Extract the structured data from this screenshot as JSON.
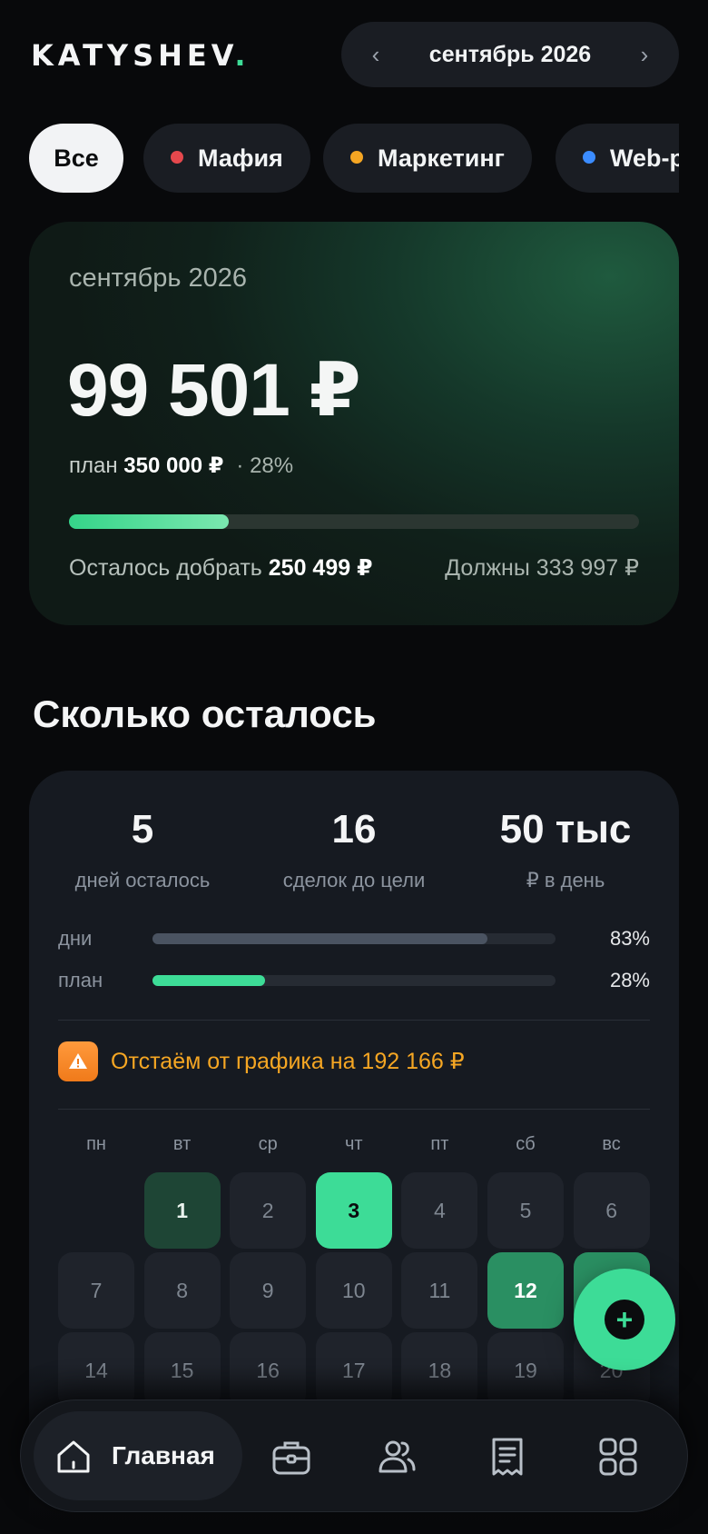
{
  "header": {
    "logo": "KATYSHEV",
    "logo_dot": ".",
    "month_label": "сентябрь 2026",
    "prev_icon": "chevron-left-icon",
    "next_icon": "chevron-right-icon",
    "prev_glyph": "‹",
    "next_glyph": "›"
  },
  "filters": [
    {
      "label": "Все",
      "active": true
    },
    {
      "label": "Мафия",
      "color": "#e5484d"
    },
    {
      "label": "Маркетинг",
      "color": "#f5a623"
    },
    {
      "label": "Web-р",
      "color": "#3b8cff"
    }
  ],
  "hero": {
    "period": "сентябрь 2026",
    "amount": "99 501 ₽",
    "plan_label": "план",
    "plan_value": "350 000 ₽",
    "plan_pct": "· 28%",
    "progress": 0.28,
    "left_label": "Осталось добрать",
    "left_value": "250 499 ₽",
    "owed": "Должны 333 997 ₽"
  },
  "remaining": {
    "title": "Сколько осталось",
    "stats": [
      {
        "num": "5",
        "cap": "дней осталось"
      },
      {
        "num": "16",
        "cap": "сделок до цели"
      },
      {
        "num": "50 тыс",
        "cap": "₽ в день"
      }
    ],
    "bars": [
      {
        "label": "дни",
        "value": "83%",
        "fraction": 0.83,
        "color": "#4a5361"
      },
      {
        "label": "план",
        "value": "28%",
        "fraction": 0.28,
        "color": "#3ddc97"
      }
    ],
    "alert": "Отстаём от графика на 192 166 ₽",
    "alert_icon": "warning-icon",
    "weekdays": [
      "пн",
      "вт",
      "ср",
      "чт",
      "пт",
      "сб",
      "вс"
    ],
    "days": [
      {
        "d": "1",
        "state": "dark"
      },
      {
        "d": "2"
      },
      {
        "d": "3",
        "state": "bright"
      },
      {
        "d": "4"
      },
      {
        "d": "5"
      },
      {
        "d": "6"
      },
      {
        "d": "7"
      },
      {
        "d": "8"
      },
      {
        "d": "9"
      },
      {
        "d": "10"
      },
      {
        "d": "11"
      },
      {
        "d": "12",
        "state": "mid"
      },
      {
        "d": "13",
        "state": "mid"
      },
      {
        "d": "14"
      },
      {
        "d": "15"
      },
      {
        "d": "16"
      },
      {
        "d": "17"
      },
      {
        "d": "18"
      },
      {
        "d": "19"
      },
      {
        "d": "20"
      }
    ]
  },
  "fab": {
    "icon": "plus-icon",
    "glyph": "+"
  },
  "tabbar": {
    "home_label": "Главная",
    "icons": [
      "home-icon",
      "briefcase-icon",
      "users-icon",
      "receipt-icon",
      "grid-icon"
    ]
  }
}
